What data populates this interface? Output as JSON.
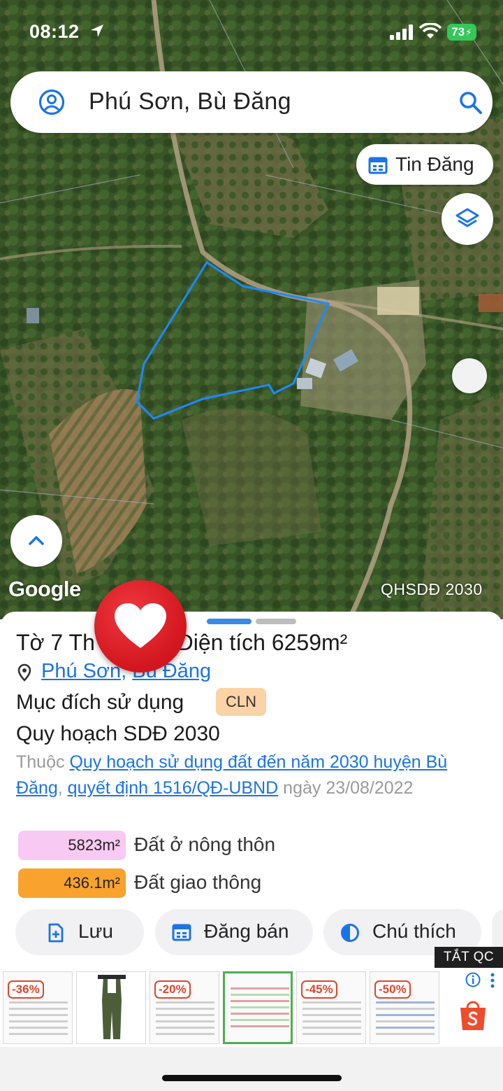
{
  "status_bar": {
    "time": "08:12",
    "battery": "73"
  },
  "search": {
    "query": "Phú Sơn, Bù Đăng"
  },
  "map": {
    "tin_dang_label": "Tin Đăng",
    "google_label": "Google",
    "overlay_label": "QHSDĐ 2030"
  },
  "parcel": {
    "title_visible_start": "Tờ 7 Th",
    "title_visible_end": ", Diện tích 6259m²",
    "addr_commune": "Phú Sơn",
    "addr_sep": ", ",
    "addr_district": "Bù Đăng",
    "purpose_label": "Mục đích sử dụng",
    "purpose_code": "CLN",
    "plan_title": "Quy hoạch SDĐ 2030",
    "desc_prefix": "Thuộc ",
    "desc_link1": "Quy hoạch sử dụng đất đến năm 2030 huyện Bù Đăng",
    "desc_sep": ", ",
    "desc_link2": "quyết định 1516/QĐ-UBND",
    "desc_suffix": " ngày 23/08/2022",
    "areas": [
      {
        "value": "5823m²",
        "label": "Đất ở nông thôn",
        "color": "#f8c9f3"
      },
      {
        "value": "436.1m²",
        "label": "Đất giao thông",
        "color": "#f9a22e"
      }
    ]
  },
  "actions": [
    {
      "label": "Lưu",
      "icon": "add-file-icon"
    },
    {
      "label": "Đăng bán",
      "icon": "calendar-icon"
    },
    {
      "label": "Chú thích",
      "icon": "half-circle-icon"
    }
  ],
  "ads": {
    "close_label": "TẮT QC",
    "discounts": [
      "-36%",
      "",
      "-20%",
      "",
      "-45%",
      "-50%"
    ]
  },
  "colors": {
    "accent": "#1b73e8",
    "parcel_outline": "#1e88ff",
    "heart": "#e3242b"
  }
}
